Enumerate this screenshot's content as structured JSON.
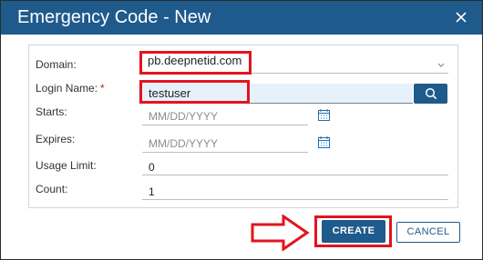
{
  "dialog": {
    "title": "Emergency Code - New",
    "close_icon": "close-icon"
  },
  "form": {
    "domain": {
      "label": "Domain:",
      "value": "pb.deepnetid.com",
      "icon": "chevron-down-icon"
    },
    "login_name": {
      "label": "Login Name:",
      "required_mark": "*",
      "value": "testuser",
      "icon": "search-icon"
    },
    "starts": {
      "label": "Starts:",
      "placeholder": "MM/DD/YYYY",
      "icon": "calendar-icon"
    },
    "expires": {
      "label": "Expires:",
      "placeholder": "MM/DD/YYYY",
      "icon": "calendar-icon"
    },
    "usage_limit": {
      "label": "Usage Limit:",
      "value": "0"
    },
    "count": {
      "label": "Count:",
      "value": "1"
    }
  },
  "buttons": {
    "create": "CREATE",
    "cancel": "CANCEL"
  },
  "annotations": {
    "highlight_color": "#e2141e",
    "arrow_icon": "right-arrow-icon"
  },
  "colors": {
    "brand": "#1f5a8c",
    "required": "#c92100",
    "login_highlight": "#e7f1fb"
  }
}
